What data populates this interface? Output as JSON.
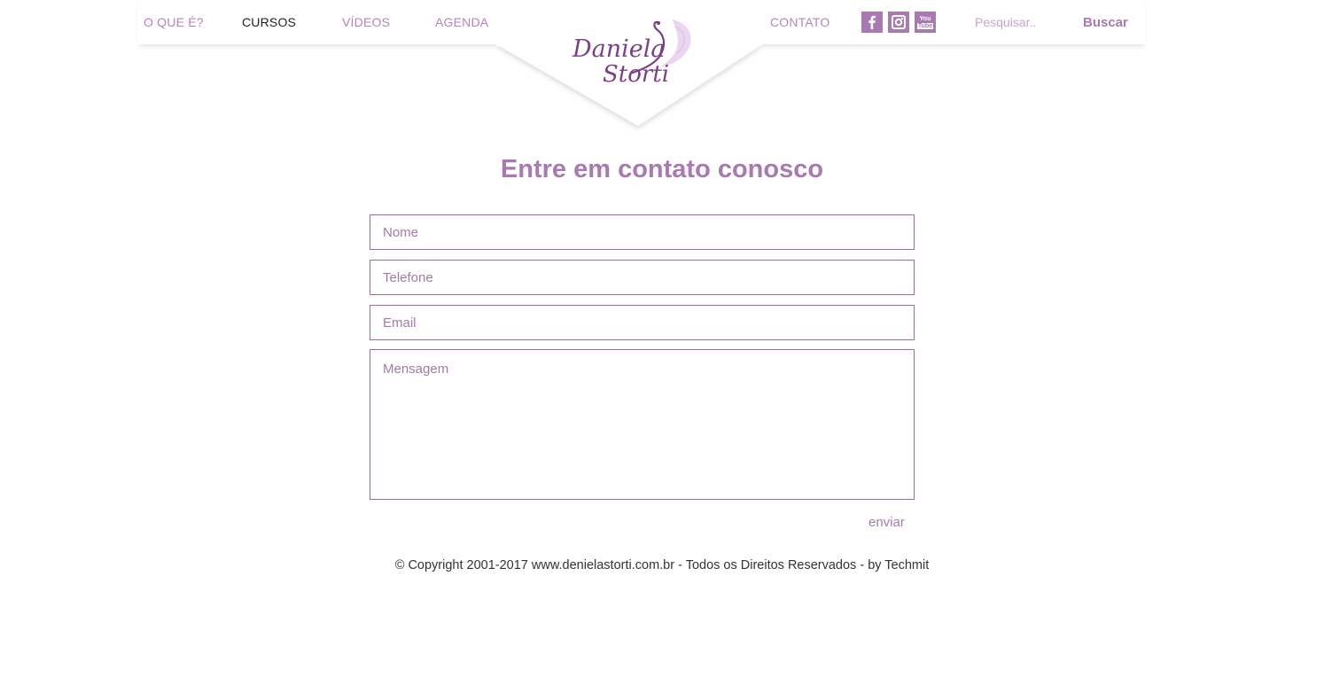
{
  "nav": {
    "items": [
      {
        "label": "O QUE É?",
        "active": false
      },
      {
        "label": "CURSOS",
        "active": true
      },
      {
        "label": "VÍDEOS",
        "active": false
      },
      {
        "label": "AGENDA",
        "active": false
      }
    ],
    "contact_label": "CONTATO",
    "social": [
      {
        "name": "facebook-icon"
      },
      {
        "name": "instagram-icon"
      },
      {
        "name": "youtube-icon",
        "text_top": "You",
        "text_bottom": "Tube"
      }
    ],
    "search": {
      "placeholder": "Pesquisar..",
      "button_label": "Buscar"
    }
  },
  "logo": {
    "line1": "Daniela",
    "line2": "Storti"
  },
  "form": {
    "title": "Entre em contato conosco",
    "name_placeholder": "Nome",
    "phone_placeholder": "Telefone",
    "email_placeholder": "Email",
    "message_placeholder": "Mensagem",
    "submit_label": "enviar"
  },
  "footer": {
    "text": "© Copyright 2001-2017 www.denielastorti.com.br - Todos os Direitos Reservados - by Techmit"
  },
  "colors": {
    "accent": "#a979b1",
    "accent_light": "#b583bd",
    "border": "#9d69a6",
    "text_dark": "#333333"
  }
}
